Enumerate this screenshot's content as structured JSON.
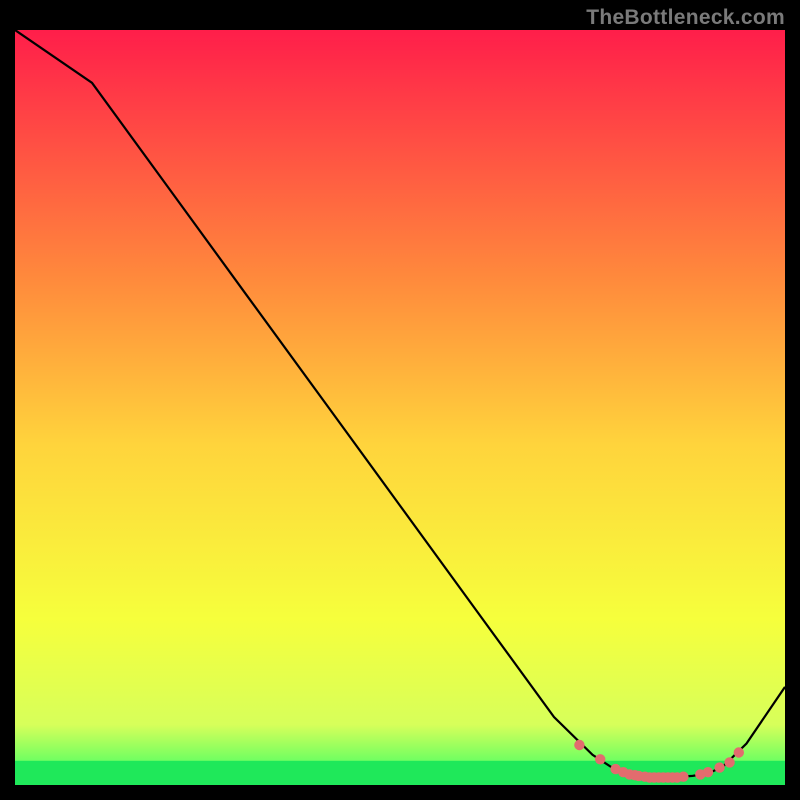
{
  "watermark": "TheBottleneck.com",
  "chart_data": {
    "type": "line",
    "title": "",
    "xlabel": "",
    "ylabel": "",
    "xlim": [
      0,
      100
    ],
    "ylim": [
      0,
      100
    ],
    "grid": false,
    "legend": false,
    "series": [
      {
        "name": "curve",
        "x": [
          0,
          10,
          20,
          30,
          40,
          50,
          60,
          70,
          75,
          78,
          80,
          82,
          85,
          88,
          90,
          92,
          95,
          100
        ],
        "y": [
          100,
          93,
          79,
          65,
          51,
          37,
          23,
          9,
          4,
          2,
          1.5,
          1.2,
          1.0,
          1.2,
          1.5,
          2.5,
          5.5,
          13
        ]
      }
    ],
    "points": {
      "name": "highlighted-points",
      "x": [
        73.3,
        76.0,
        78.0,
        79.0,
        79.8,
        80.5,
        81.0,
        81.8,
        82.4,
        83.0,
        83.6,
        84.2,
        84.8,
        85.4,
        86.0,
        86.8,
        89.0,
        90.0,
        91.5,
        92.8,
        94.0
      ],
      "y": [
        5.3,
        3.4,
        2.1,
        1.7,
        1.4,
        1.3,
        1.2,
        1.1,
        1.0,
        1.0,
        1.0,
        1.0,
        1.0,
        1.0,
        1.0,
        1.1,
        1.4,
        1.7,
        2.3,
        3.0,
        4.3
      ]
    },
    "green_band": {
      "bottom": 0,
      "top": 3.2
    },
    "gradient_colors": {
      "top": "#FF1E4A",
      "upper_mid": "#FF8A3C",
      "mid": "#FFD43C",
      "lower_mid": "#F6FF3C",
      "near_bottom": "#D7FF5A",
      "bottom": "#2BFF66"
    },
    "point_color": "#E26C6E",
    "curve_color": "#000000"
  }
}
